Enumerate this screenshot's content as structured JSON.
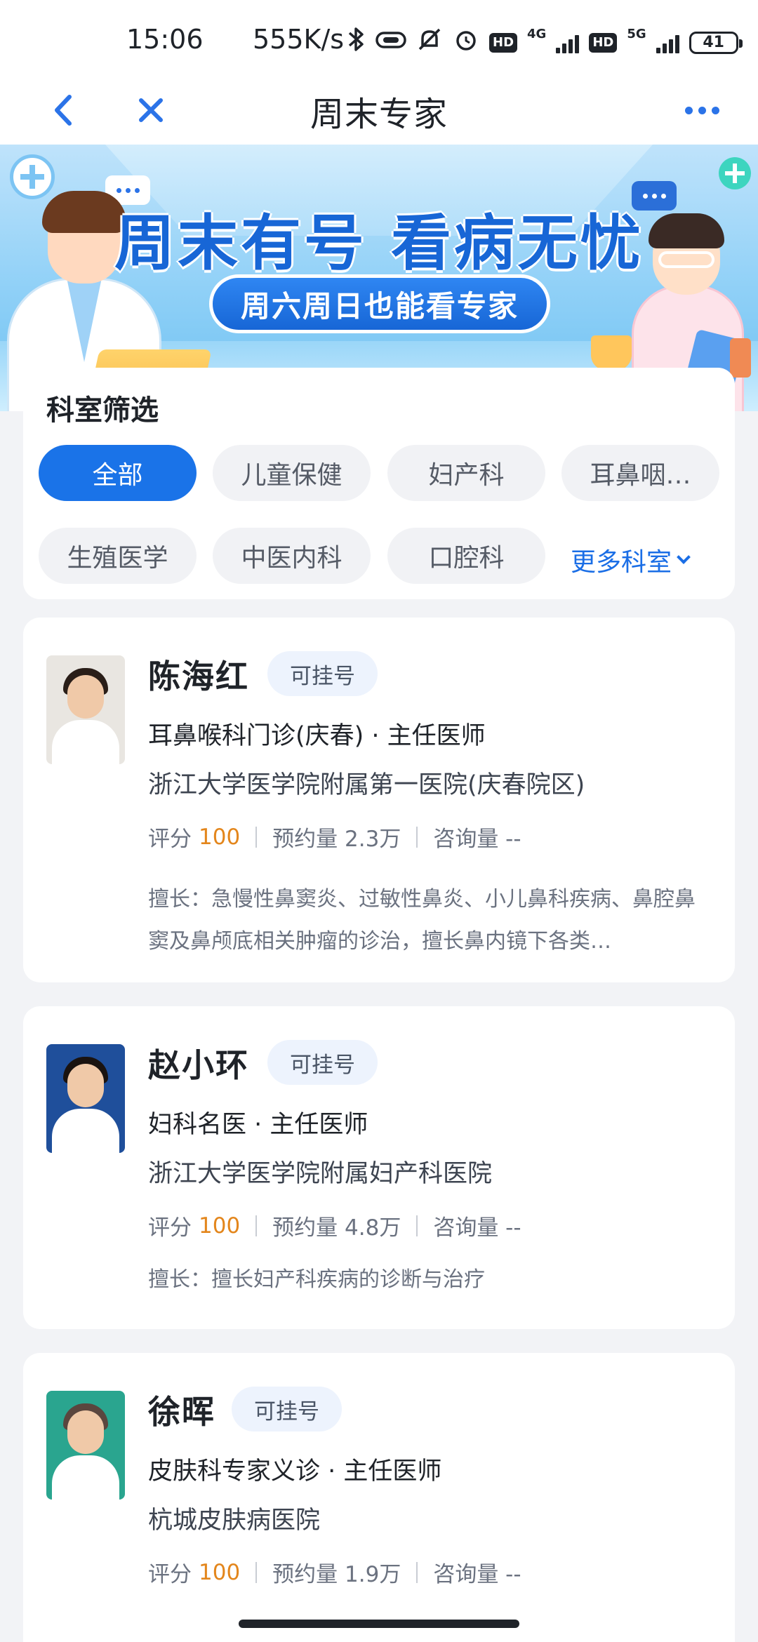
{
  "status_bar": {
    "time": "15:06",
    "speed": "555K/s",
    "net1": "4G",
    "net2": "5G",
    "hd": "HD",
    "battery": "41"
  },
  "nav": {
    "title": "周末专家"
  },
  "banner": {
    "headline": "周末有号 看病无忧",
    "subline": "周六周日也能看专家"
  },
  "filter": {
    "title": "科室筛选",
    "chips": [
      "全部",
      "儿童保健",
      "妇产科",
      "耳鼻咽…",
      "生殖医学",
      "中医内科",
      "口腔科"
    ],
    "more_label": "更多科室"
  },
  "doctors": [
    {
      "name": "陈海红",
      "badge": "可挂号",
      "title": "耳鼻喉科门诊(庆春) · 主任医师",
      "hospital": "浙江大学医学院附属第一医院(庆春院区)",
      "score_label": "评分",
      "score": "100",
      "appointments": "预约量 2.3万",
      "consults": "咨询量 --",
      "skill": "擅长：急慢性鼻窦炎、过敏性鼻炎、小儿鼻科疾病、鼻腔鼻窦及鼻颅底相关肿瘤的诊治，擅长鼻内镜下各类…"
    },
    {
      "name": "赵小环",
      "badge": "可挂号",
      "title": "妇科名医 · 主任医师",
      "hospital": "浙江大学医学院附属妇产科医院",
      "score_label": "评分",
      "score": "100",
      "appointments": "预约量 4.8万",
      "consults": "咨询量 --",
      "skill": "擅长：擅长妇产科疾病的诊断与治疗"
    },
    {
      "name": "徐晖",
      "badge": "可挂号",
      "title": "皮肤科专家义诊 · 主任医师",
      "hospital": "杭城皮肤病医院",
      "score_label": "评分",
      "score": "100",
      "appointments": "预约量 1.9万",
      "consults": "咨询量 --",
      "skill": ""
    }
  ],
  "colors": {
    "accent": "#1a73e8",
    "score": "#e3861c",
    "background": "#f2f3f6"
  },
  "icons": {
    "back": "chevron-left-icon",
    "close": "close-icon",
    "more": "more-dots-icon",
    "more_dept": "chevron-down-icon"
  }
}
